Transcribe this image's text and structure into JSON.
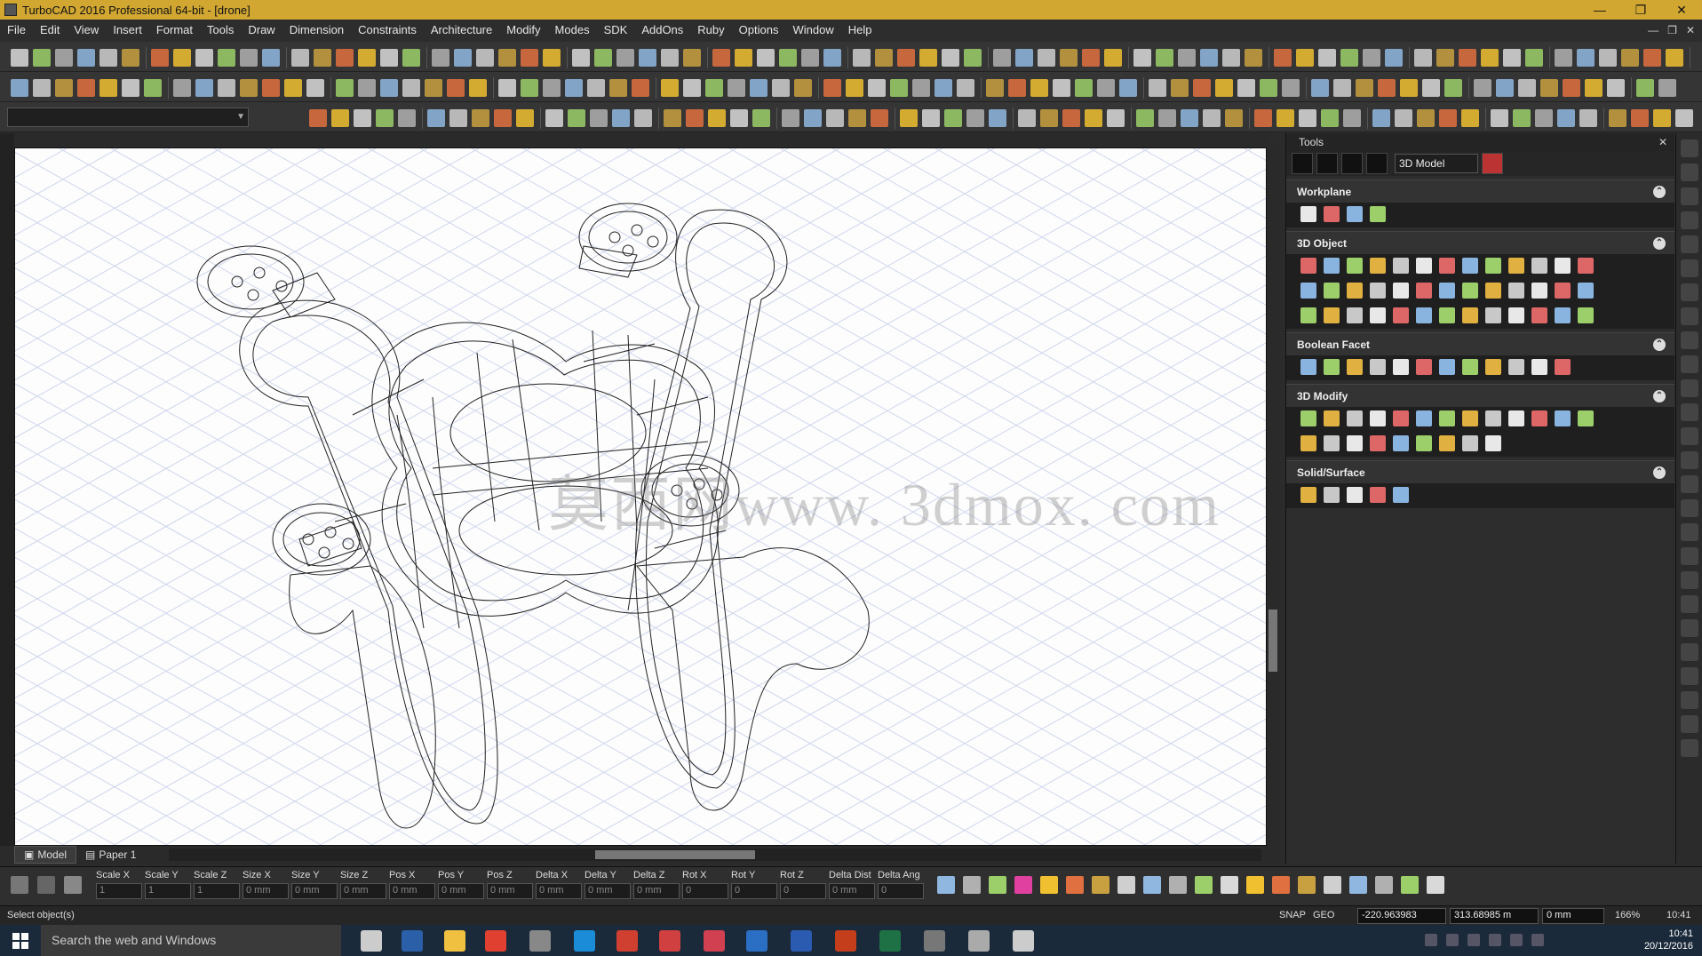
{
  "window": {
    "title": "TurboCAD 2016 Professional 64-bit - [drone]",
    "buttons": [
      "—",
      "❐",
      "✕"
    ]
  },
  "menu": [
    "File",
    "Edit",
    "View",
    "Insert",
    "Format",
    "Tools",
    "Draw",
    "Dimension",
    "Constraints",
    "Architecture",
    "Modify",
    "Modes",
    "SDK",
    "AddOns",
    "Ruby",
    "Options",
    "Window",
    "Help"
  ],
  "menu_right": [
    "—",
    "❐",
    "✕"
  ],
  "watermark": "莫西网www. 3dmox. com",
  "viewport_tabs": {
    "model": "Model",
    "paper": "Paper 1"
  },
  "panel": {
    "title": "Tools",
    "mode_select": "3D Model",
    "sections": [
      {
        "title": "Workplane",
        "icon_count": 4
      },
      {
        "title": "3D Object",
        "icon_count": 39
      },
      {
        "title": "Boolean Facet",
        "icon_count": 12
      },
      {
        "title": "3D Modify",
        "icon_count": 22
      },
      {
        "title": "Solid/Surface",
        "icon_count": 5
      }
    ]
  },
  "coord_labels": [
    "Scale X",
    "Scale Y",
    "Scale Z",
    "Size X",
    "Size Y",
    "Size Z",
    "Pos X",
    "Pos Y",
    "Pos Z",
    "Delta X",
    "Delta Y",
    "Delta Z",
    "Rot X",
    "Rot Y",
    "Rot Z",
    "Delta Dist",
    "Delta Ang"
  ],
  "coord_values": [
    "1",
    "1",
    "1",
    "0 mm",
    "0 mm",
    "0 mm",
    "0 mm",
    "0 mm",
    "0 mm",
    "0 mm",
    "0 mm",
    "0 mm",
    "0",
    "0",
    "0",
    "0 mm",
    "0"
  ],
  "status": {
    "prompt": "Select object(s)",
    "snap": "SNAP",
    "geo": "GEO",
    "x": "-220.963983",
    "y": "313.68985 m",
    "z": "0 mm",
    "zoom": "166%",
    "time": "10:41"
  },
  "taskbar": {
    "search_placeholder": "Search the web and Windows",
    "time": "10:41",
    "date": "20/12/2016"
  }
}
